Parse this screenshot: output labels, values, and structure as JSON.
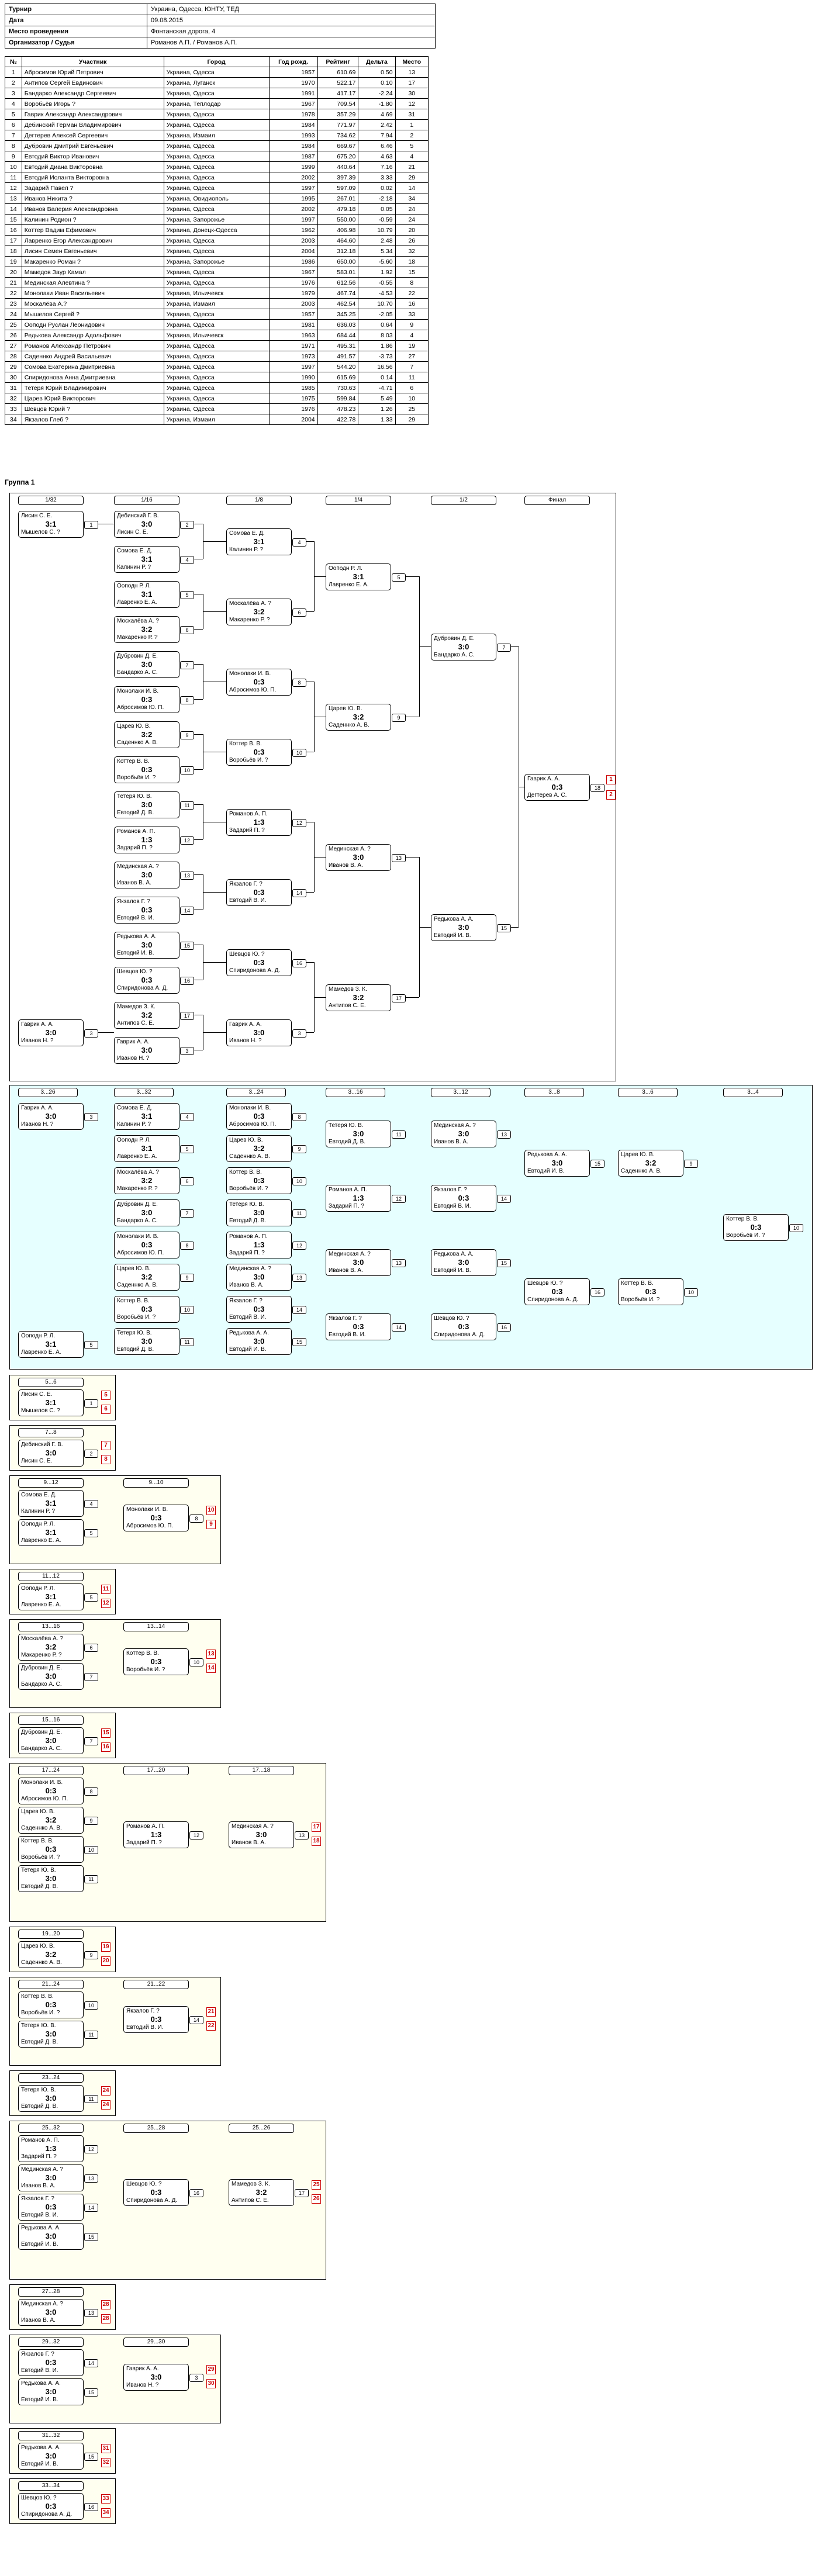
{
  "info": [
    {
      "label": "Турнир",
      "value": "Украина, Одесса, ЮНТУ, ТЕД"
    },
    {
      "label": "Дата",
      "value": "09.08.2015"
    },
    {
      "label": "Место проведения",
      "value": "Фонтанская дорога, 4"
    },
    {
      "label": "Организатор / Судья",
      "value": "Романов А.П. / Романов А.П."
    }
  ],
  "players_header": [
    "№",
    "Участник",
    "Город",
    "Год рожд.",
    "Рейтинг",
    "Дельта",
    "Место"
  ],
  "players": [
    [
      "1",
      "Абросимов Юрий Петрович",
      "Украина, Одесса",
      "1957",
      "610.69",
      "0.50",
      "13"
    ],
    [
      "2",
      "Антипов Сергей Евдинович",
      "Украина, Луганск",
      "1970",
      "522.17",
      "0.10",
      "17"
    ],
    [
      "3",
      "Бандарко Александр Сергеевич",
      "Украина, Одесса",
      "1991",
      "417.17",
      "-2.24",
      "30"
    ],
    [
      "4",
      "Воробьёв Игорь ?",
      "Украина, Теплодар",
      "1967",
      "709.54",
      "-1.80",
      "12"
    ],
    [
      "5",
      "Гаврик Александр Александрович",
      "Украина, Одесса",
      "1978",
      "357.29",
      "4.69",
      "31"
    ],
    [
      "6",
      "Дебинский Герман Владимирович",
      "Украина, Одесса",
      "1984",
      "771.97",
      "2.42",
      "1"
    ],
    [
      "7",
      "Дегтерев Алексей Сергеевич",
      "Украина, Измаил",
      "1993",
      "734.62",
      "7.94",
      "2"
    ],
    [
      "8",
      "Дубровин Дмитрий Евгеньевич",
      "Украина, Одесса",
      "1984",
      "669.67",
      "6.46",
      "5"
    ],
    [
      "9",
      "Евтодий Виктор Иванович",
      "Украина, Одесса",
      "1987",
      "675.20",
      "4.63",
      "4"
    ],
    [
      "10",
      "Евтодий Диана Викторовна",
      "Украина, Одесса",
      "1999",
      "440.64",
      "7.16",
      "21"
    ],
    [
      "11",
      "Евтодий Иоланта Викторовна",
      "Украина, Одесса",
      "2002",
      "397.39",
      "3.33",
      "29"
    ],
    [
      "12",
      "Задарий Павел ?",
      "Украина, Одесса",
      "1997",
      "597.09",
      "0.02",
      "14"
    ],
    [
      "13",
      "Иванов Никита ?",
      "Украина, Овидиополь",
      "1995",
      "267.01",
      "-2.18",
      "34"
    ],
    [
      "14",
      "Иванов Валерия Александровна",
      "Украина, Одесса",
      "2002",
      "479.18",
      "0.05",
      "24"
    ],
    [
      "15",
      "Калинин Родион ?",
      "Украина, Запорожье",
      "1997",
      "550.00",
      "-0.59",
      "24"
    ],
    [
      "16",
      "Коттер Вадим Ефимович",
      "Украина, Донецк-Одесса",
      "1962",
      "406.98",
      "10.79",
      "20"
    ],
    [
      "17",
      "Лавренко Егор Александрович",
      "Украина, Одесса",
      "2003",
      "464.60",
      "2.48",
      "26"
    ],
    [
      "18",
      "Лисин Семен Евгеньевич",
      "Украина, Одесса",
      "2004",
      "312.18",
      "5.34",
      "32"
    ],
    [
      "19",
      "Макаренко Роман ?",
      "Украина, Запорожье",
      "1986",
      "650.00",
      "-5.60",
      "18"
    ],
    [
      "20",
      "Мамедов Заур Камал",
      "Украина, Одесса",
      "1967",
      "583.01",
      "1.92",
      "15"
    ],
    [
      "21",
      "Мединская Алевтина ?",
      "Украина, Одесса",
      "1976",
      "612.56",
      "-0.55",
      "8"
    ],
    [
      "22",
      "Монолаки Иван Васильевич",
      "Украина, Ильичевск",
      "1979",
      "467.74",
      "-4.53",
      "22"
    ],
    [
      "23",
      "Москалёва А.?",
      "Украина, Измаил",
      "2003",
      "462.54",
      "10.70",
      "16"
    ],
    [
      "24",
      "Мышелов Сергей ?",
      "Украина, Одесса",
      "1957",
      "345.25",
      "-2.05",
      "33"
    ],
    [
      "25",
      "Ооподн Руслан Леонидович",
      "Украина, Одесса",
      "1981",
      "636.03",
      "0.64",
      "9"
    ],
    [
      "26",
      "Редькова Александр Адольфович",
      "Украина, Ильичевск",
      "1963",
      "684.44",
      "8.03",
      "4"
    ],
    [
      "27",
      "Романов Александр Петрович",
      "Украина, Одесса",
      "1971",
      "495.31",
      "1.86",
      "19"
    ],
    [
      "28",
      "Саденнко Андрей Васильевич",
      "Украина, Одесса",
      "1973",
      "491.57",
      "-3.73",
      "27"
    ],
    [
      "29",
      "Сомова Екатерина Дмитриевна",
      "Украина, Одесса",
      "1997",
      "544.20",
      "16.56",
      "7"
    ],
    [
      "30",
      "Спиридонова Анна Дмитриевна",
      "Украина, Одесса",
      "1990",
      "615.69",
      "0.14",
      "11"
    ],
    [
      "31",
      "Тетеря Юрий Владимирович",
      "Украина, Одесса",
      "1985",
      "730.63",
      "-4.71",
      "6"
    ],
    [
      "32",
      "Царев Юрий Викторович",
      "Украина, Одесса",
      "1975",
      "599.84",
      "5.49",
      "10"
    ],
    [
      "33",
      "Шевцов Юрий ?",
      "Украина, Одесса",
      "1976",
      "478.23",
      "1.26",
      "25"
    ],
    [
      "34",
      "Якзалов Глеб ?",
      "Украина, Измаил",
      "2004",
      "422.78",
      "1.33",
      "29"
    ]
  ],
  "group_title": "Группа 1",
  "main_stages": [
    "1/32",
    "1/16",
    "1/8",
    "1/4",
    "1/2",
    "Финал"
  ],
  "main_matches": [
    {
      "a": "Лисин С. Е.",
      "b": "Мышелов С. ?",
      "score": "3:1",
      "num": "1"
    },
    {
      "a": "Дебинский Г. В.",
      "b": "Лисин С. Е.",
      "score": "3:0",
      "num": "2"
    },
    {
      "a": "Сомова Е. Д.",
      "b": "Калинин Р. ?",
      "score": "3:1",
      "num": "4"
    },
    {
      "a": "Ооподн Р. Л.",
      "b": "Лавренко Е. А.",
      "score": "3:1",
      "num": "5"
    },
    {
      "a": "Москалёва А. ?",
      "b": "Макаренко Р. ?",
      "score": "3:2",
      "num": "6"
    },
    {
      "a": "Дубровин Д. Е.",
      "b": "Бандарко А. С.",
      "score": "3:0",
      "num": "7"
    },
    {
      "a": "Монолаки И. В.",
      "b": "Абросимов Ю. П.",
      "score": "0:3",
      "num": "8"
    },
    {
      "a": "Царев Ю. В.",
      "b": "Саденнко А. В.",
      "score": "3:2",
      "num": "9"
    },
    {
      "a": "Коттер В. В.",
      "b": "Воробьёв И. ?",
      "score": "0:3",
      "num": "10"
    },
    {
      "a": "Тетеря Ю. В.",
      "b": "Евтодий Д. В.",
      "score": "3:0",
      "num": "11"
    },
    {
      "a": "Романов А. П.",
      "b": "Задарий П. ?",
      "score": "1:3",
      "num": "12"
    },
    {
      "a": "Мединская А. ?",
      "b": "Иванов В. А.",
      "score": "3:0",
      "num": "13"
    },
    {
      "a": "Якзалов Г. ?",
      "b": "Евтодий В. И.",
      "score": "0:3",
      "num": "14"
    },
    {
      "a": "Редькова А. А.",
      "b": "Евтодий И. В.",
      "score": "3:0",
      "num": "15"
    },
    {
      "a": "Шевцов Ю. ?",
      "b": "Спиридонова А. Д.",
      "score": "0:3",
      "num": "16"
    },
    {
      "a": "Мамедов З. К.",
      "b": "Антипов С. Е.",
      "score": "3:2",
      "num": "17"
    },
    {
      "a": "Гаврик А. А.",
      "b": "Иванов Н. ?",
      "score": "3:0",
      "num": "3"
    },
    {
      "a": "Гаврик А. А.",
      "b": "Дегтерев А. С.",
      "score": "0:3",
      "num": "18"
    }
  ],
  "final_places": [
    "1",
    "2"
  ],
  "cyan_stages": [
    "3...26",
    "3...32",
    "3...24",
    "3...16",
    "3...12",
    "3...8",
    "3...6",
    "3...4"
  ],
  "panels": [
    {
      "title": "5...6",
      "places": [
        "5",
        "6"
      ]
    },
    {
      "title": "7...8",
      "places": [
        "7",
        "8"
      ]
    },
    {
      "title": "9...12",
      "title2": "9...10",
      "places": [
        "10",
        "9"
      ]
    },
    {
      "title": "11...12",
      "places": [
        "11",
        "12"
      ]
    },
    {
      "title": "13...16",
      "title2": "13...14",
      "places": [
        "13",
        "14"
      ]
    },
    {
      "title": "15...16",
      "places": [
        "15",
        "16"
      ]
    },
    {
      "title": "17...24",
      "title2": "17...20",
      "title3": "17...18",
      "places": [
        "17",
        "18"
      ]
    },
    {
      "title": "19...20",
      "places": [
        "19",
        "20"
      ]
    },
    {
      "title": "21...24",
      "title2": "21...22",
      "places": [
        "21",
        "22"
      ]
    },
    {
      "title": "23...24",
      "places": [
        "24",
        "24"
      ]
    },
    {
      "title": "25...32",
      "title2": "25...28",
      "title3": "25...26",
      "places": [
        "25",
        "26"
      ]
    },
    {
      "title": "27...28",
      "places": [
        "28",
        "28"
      ]
    },
    {
      "title": "29...32",
      "title2": "29...30",
      "places": [
        "29",
        "30"
      ]
    },
    {
      "title": "31...32",
      "places": [
        "31",
        "32"
      ]
    },
    {
      "title": "33...34",
      "places": [
        "33",
        "34"
      ]
    }
  ]
}
